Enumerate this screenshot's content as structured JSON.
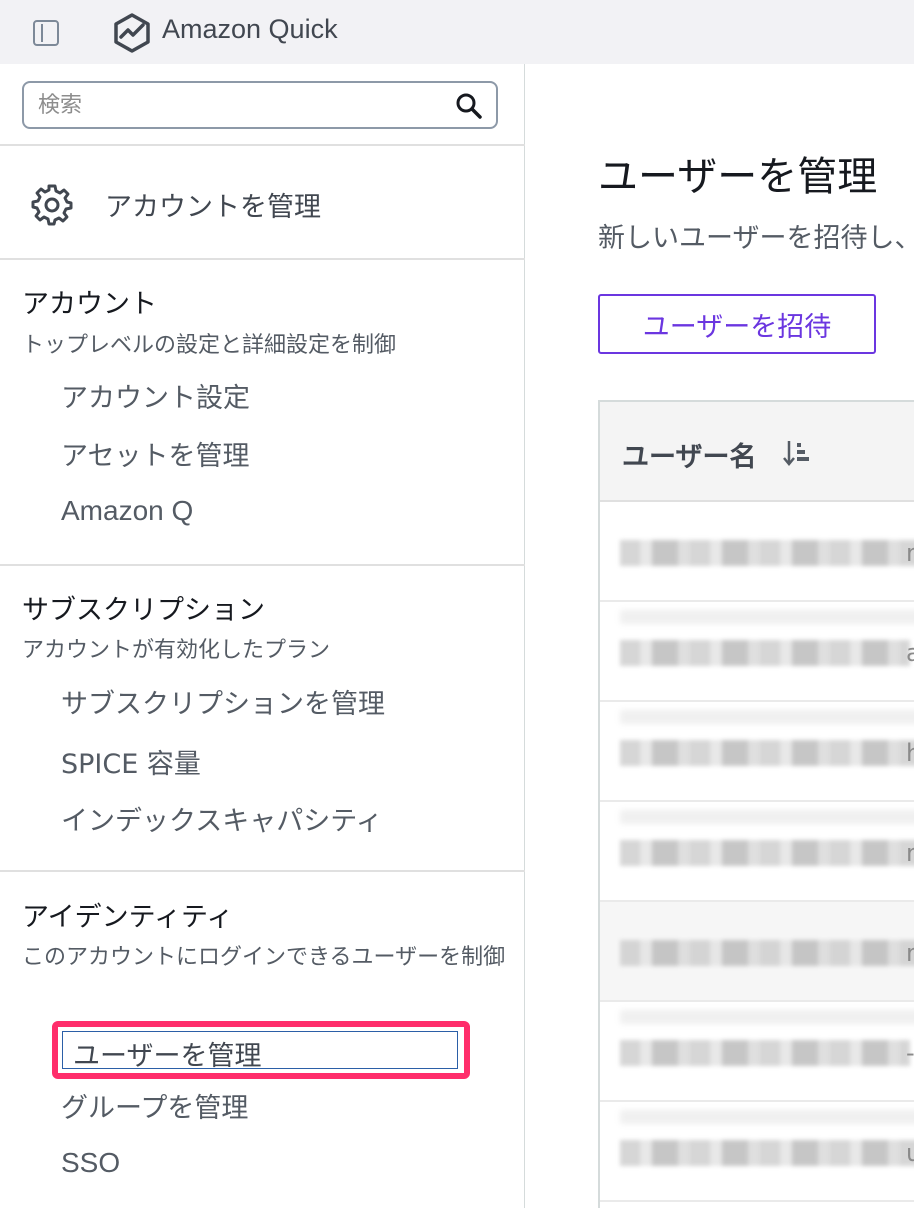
{
  "topbar": {
    "app_title": "Amazon Quick",
    "panel_toggle_icon": "panel-toggle-icon",
    "logo_icon": "amazon-quick-logo-icon"
  },
  "sidebar": {
    "search": {
      "placeholder": "検索",
      "value": "",
      "icon": "search-icon"
    },
    "manage_account": {
      "label": "アカウントを管理",
      "icon": "gear-icon"
    },
    "sections": [
      {
        "title": "アカウント",
        "description": "トップレベルの設定と詳細設定を制御",
        "items": [
          "アカウント設定",
          "アセットを管理",
          "Amazon Q"
        ]
      },
      {
        "title": "サブスクリプション",
        "description": "アカウントが有効化したプラン",
        "items": [
          "サブスクリプションを管理",
          "SPICE 容量",
          "インデックスキャパシティ"
        ]
      },
      {
        "title": "アイデンティティ",
        "description": "このアカウントにログインできるユーザーを制御",
        "items": [
          "ユーザーを管理",
          "グループを管理",
          "SSO"
        ]
      }
    ],
    "active_item": "ユーザーを管理",
    "highlight_color": "#ff2d6b"
  },
  "main": {
    "title": "ユーザーを管理",
    "description": "新しいユーザーを招待し、",
    "invite_button": "ユーザーを招待",
    "accent_color": "#6b36e0",
    "table": {
      "columns": [
        "ユーザー名"
      ],
      "sort_icon": "sort-descending-icon",
      "row_edges": [
        "m",
        "a",
        "h",
        "n",
        "m",
        "-",
        "u"
      ]
    }
  }
}
